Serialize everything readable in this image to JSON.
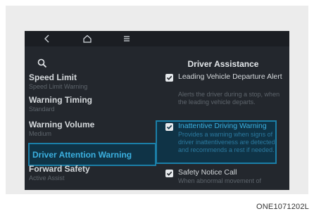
{
  "topbar": {
    "back_icon": "chevron-left-icon",
    "home_icon": "home-icon",
    "menu_icon": "menu-icon"
  },
  "search_icon": "search-icon",
  "menu": {
    "items": [
      {
        "title": "Speed Limit",
        "sub": "Speed Limit Warning"
      },
      {
        "title": "Warning Timing",
        "sub": "Standard"
      },
      {
        "title": "Warning Volume",
        "sub": "Medium"
      },
      {
        "title": "Driver Attention Warning",
        "sub": ""
      },
      {
        "title": "Forward Safety",
        "sub": "Active Assist"
      }
    ],
    "selected_index": 3
  },
  "panel": {
    "title": "Driver Assistance",
    "options": [
      {
        "label": "Leading Vehicle Departure Alert",
        "desc": "Alerts the driver during a stop, when the leading vehicle departs.",
        "checked": true
      },
      {
        "label": "Inattentive Driving Warning",
        "desc": "Provides a warning when signs of driver inattentiveness are detected, and recommends a rest if needed.",
        "checked": true
      },
      {
        "label": "Safety Notice Call",
        "desc": "When abnormal movement of",
        "checked": true
      }
    ]
  },
  "caption": "ONE1071202L",
  "colors": {
    "screen_bg": "#23272d",
    "highlight": "#3bb0e0",
    "highlight_border": "#1b7fa8"
  }
}
